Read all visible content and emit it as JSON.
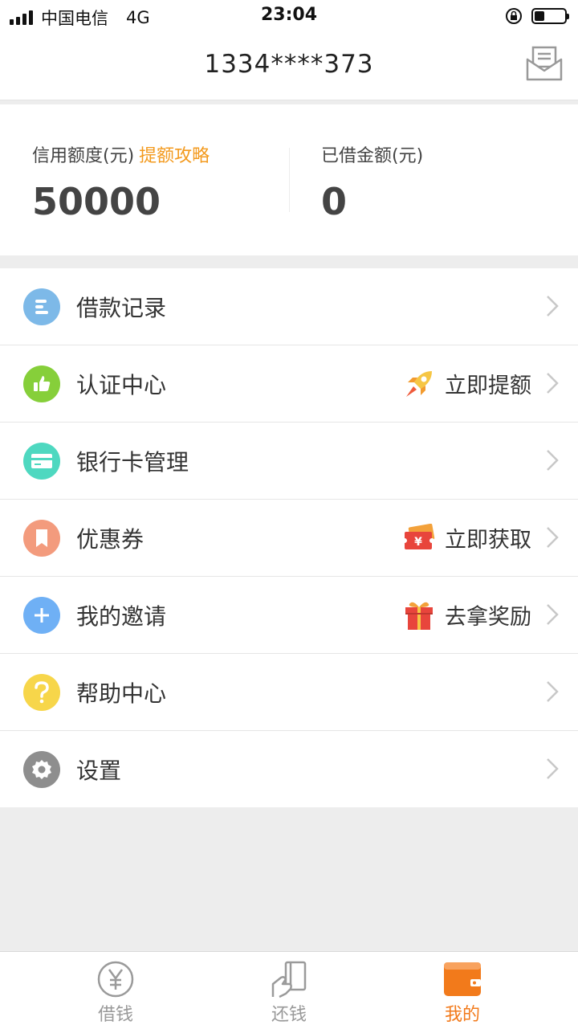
{
  "status_bar": {
    "carrier": "中国电信",
    "network": "4G",
    "time": "23:04"
  },
  "header": {
    "title": "1334****373",
    "message_icon": "mail-inbox-icon"
  },
  "credit": {
    "limit_label": "信用额度(元)",
    "limit_link": "提额攻略",
    "limit_value": "50000",
    "borrowed_label": "已借金额(元)",
    "borrowed_value": "0"
  },
  "menu": {
    "items": [
      {
        "label": "借款记录",
        "icon": "list-icon",
        "color": "#7db9e8"
      },
      {
        "label": "认证中心",
        "icon": "thumbs-up-icon",
        "color": "#86cf3a",
        "action": "立即提额",
        "action_icon": "rocket-icon"
      },
      {
        "label": "银行卡管理",
        "icon": "bank-card-icon",
        "color": "#4ed8c0"
      },
      {
        "label": "优惠券",
        "icon": "bookmark-icon",
        "color": "#f39b7d",
        "action": "立即获取",
        "action_icon": "coupon-icon"
      },
      {
        "label": "我的邀请",
        "icon": "plus-icon",
        "color": "#6fb0f5",
        "action": "去拿奖励",
        "action_icon": "gift-icon"
      },
      {
        "label": "帮助中心",
        "icon": "question-icon",
        "color": "#f7d64a"
      },
      {
        "label": "设置",
        "icon": "gear-icon",
        "color": "#8e8e8e"
      }
    ]
  },
  "tabbar": {
    "tabs": [
      {
        "label": "借钱",
        "icon": "yen-coin-icon"
      },
      {
        "label": "还钱",
        "icon": "hand-card-icon"
      },
      {
        "label": "我的",
        "icon": "wallet-icon",
        "active": true
      }
    ]
  },
  "colors": {
    "accent": "#f27a1b",
    "link": "#f39a1e",
    "background": "#ededed"
  }
}
